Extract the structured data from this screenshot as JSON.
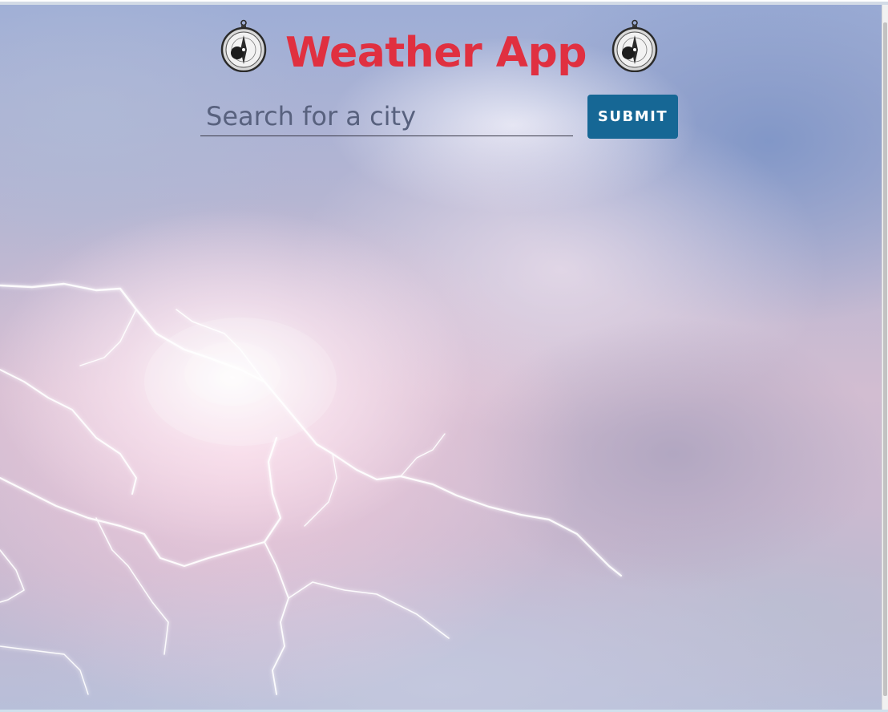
{
  "header": {
    "title": "Weather App",
    "left_icon": "compass-icon",
    "right_icon": "compass-icon",
    "title_color": "#e03040"
  },
  "search": {
    "placeholder": "Search for a city",
    "value": "",
    "submit_label": "SUBMIT",
    "button_color": "#166795"
  },
  "background": {
    "image": "thunderstorm-lightning-sky"
  }
}
